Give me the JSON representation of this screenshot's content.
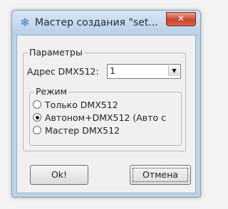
{
  "window": {
    "title": "Мастер создания \"set...",
    "close_symbol": "✕",
    "icon": "snowflake-icon"
  },
  "params_group": {
    "label": "Параметры",
    "address_label": "Адрес DMX512:",
    "address_value": "1"
  },
  "mode_group": {
    "label": "Режим",
    "options": [
      {
        "label": "Только DMX512",
        "checked": false
      },
      {
        "label": "Автоном+DMX512 (Авто с",
        "checked": true
      },
      {
        "label": "Мастер DMX512",
        "checked": false
      }
    ]
  },
  "buttons": {
    "ok_label": "Ok!",
    "cancel_label": "Отмена"
  }
}
